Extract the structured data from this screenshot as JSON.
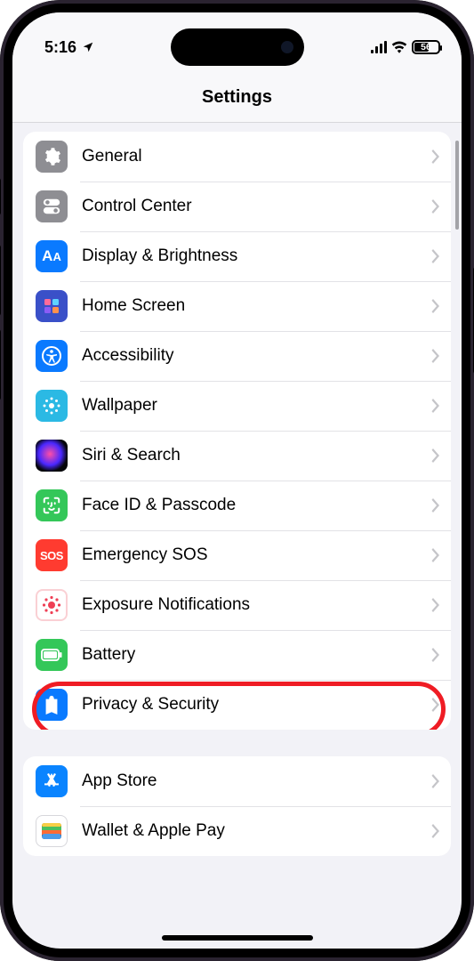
{
  "status": {
    "time": "5:16",
    "battery_level": "56"
  },
  "page_title": "Settings",
  "groups": [
    {
      "items": [
        {
          "id": "general",
          "label": "General",
          "icon": "gear-icon"
        },
        {
          "id": "control-center",
          "label": "Control Center",
          "icon": "control-center-icon"
        },
        {
          "id": "display",
          "label": "Display & Brightness",
          "icon": "display-icon"
        },
        {
          "id": "home-screen",
          "label": "Home Screen",
          "icon": "home-screen-icon"
        },
        {
          "id": "accessibility",
          "label": "Accessibility",
          "icon": "accessibility-icon"
        },
        {
          "id": "wallpaper",
          "label": "Wallpaper",
          "icon": "wallpaper-icon"
        },
        {
          "id": "siri",
          "label": "Siri & Search",
          "icon": "siri-icon"
        },
        {
          "id": "faceid",
          "label": "Face ID & Passcode",
          "icon": "faceid-icon"
        },
        {
          "id": "sos",
          "label": "Emergency SOS",
          "icon": "sos-icon",
          "icon_text": "SOS"
        },
        {
          "id": "exposure",
          "label": "Exposure Notifications",
          "icon": "exposure-icon"
        },
        {
          "id": "battery",
          "label": "Battery",
          "icon": "battery-icon"
        },
        {
          "id": "privacy",
          "label": "Privacy & Security",
          "icon": "privacy-icon",
          "highlighted": true
        }
      ]
    },
    {
      "items": [
        {
          "id": "appstore",
          "label": "App Store",
          "icon": "appstore-icon"
        },
        {
          "id": "wallet",
          "label": "Wallet & Apple Pay",
          "icon": "wallet-icon"
        }
      ]
    }
  ]
}
